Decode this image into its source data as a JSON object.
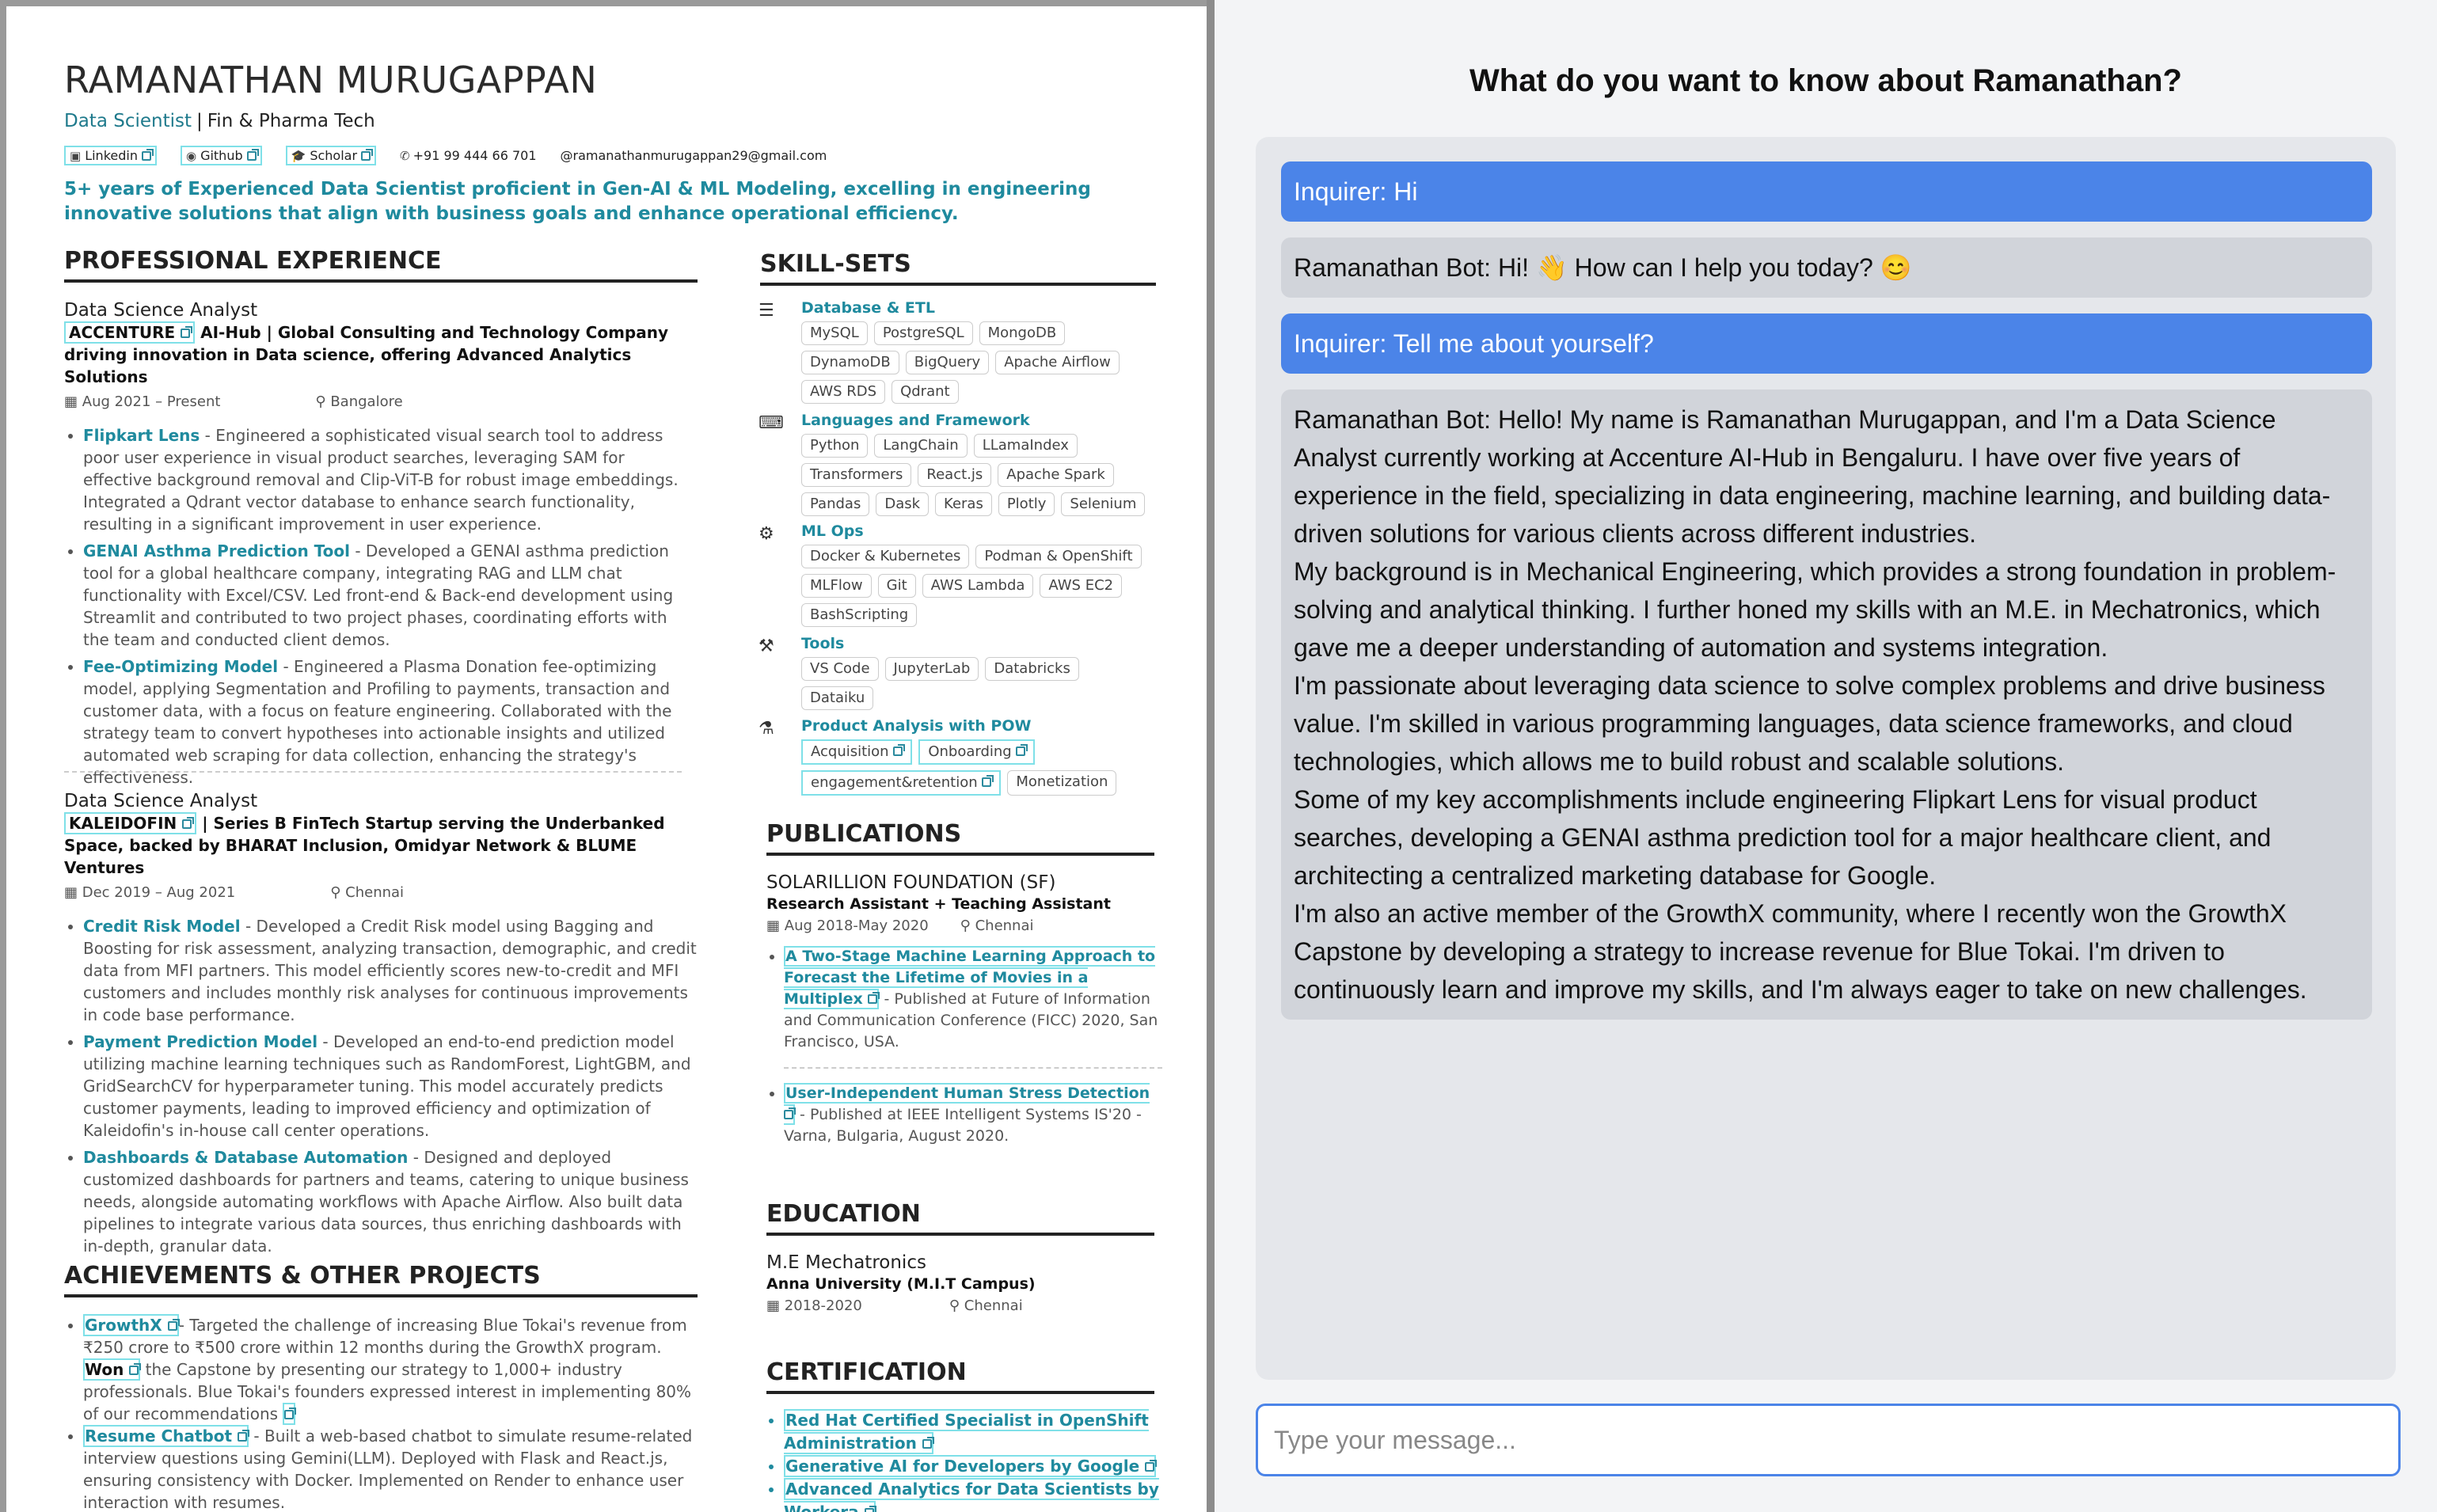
{
  "resume": {
    "name": "RAMANATHAN MURUGAPPAN",
    "role": "Data Scientist",
    "domain": "Fin & Pharma Tech",
    "links": [
      {
        "label": "Linkedin",
        "icon": "linkedin-icon"
      },
      {
        "label": "Github",
        "icon": "github-icon"
      },
      {
        "label": "Scholar",
        "icon": "graduation-cap-icon"
      }
    ],
    "phone": "+91 99 444 66 701",
    "email": "@ramanathanmurugappan29@gmail.com",
    "summary": "5+ years of Experienced Data Scientist proficient in Gen-AI & ML Modeling, excelling in engineering innovative solutions that align with business goals and enhance operational efficiency.",
    "sections": {
      "experience": "PROFESSIONAL EXPERIENCE",
      "skills": "SKILL-SETS",
      "publications": "PUBLICATIONS",
      "education": "EDUCATION",
      "certification": "CERTIFICATION",
      "achievements": "ACHIEVEMENTS & OTHER PROJECTS"
    },
    "jobs": [
      {
        "title": "Data Science Analyst",
        "company": "ACCENTURE",
        "company_desc": "AI-Hub | Global Consulting and Technology Company driving innovation in Data science, offering Advanced Analytics Solutions",
        "dates": "Aug 2021 – Present",
        "location": "Bangalore",
        "bullets": [
          {
            "head": "Flipkart Lens",
            "text": " - Engineered a sophisticated visual search tool to address poor user experience in visual product searches, leveraging SAM for effective background removal and Clip-ViT-B for robust image embeddings. Integrated a Qdrant vector database to enhance search functionality, resulting in a significant improvement in user experience."
          },
          {
            "head": "GENAI Asthma Prediction Tool",
            "text": " - Developed a GENAI asthma prediction tool for a global healthcare company, integrating RAG and LLM chat functionality with Excel/CSV. Led front-end & Back-end development using Streamlit and contributed to two project phases, coordinating efforts with the team and conducted client demos."
          },
          {
            "head": "Fee-Optimizing Model",
            "text": " - Engineered a Plasma Donation fee-optimizing model, applying Segmentation and Profiling to payments, transaction and customer data, with a focus on feature engineering. Collaborated with the strategy team to convert hypotheses into actionable insights and utilized automated web scraping for data collection, enhancing the strategy's effectiveness."
          }
        ]
      },
      {
        "title": "Data Science Analyst",
        "company": "KALEIDOFIN",
        "company_desc": "| Series B FinTech Startup serving the Underbanked Space, backed by BHARAT Inclusion, Omidyar Network & BLUME Ventures",
        "dates": "Dec 2019 – Aug 2021",
        "location": "Chennai",
        "bullets": [
          {
            "head": "Credit Risk Model",
            "text": " - Developed a Credit Risk model using Bagging and Boosting for risk assessment, analyzing transaction, demographic, and credit data from MFI partners. This model efficiently scores new-to-credit and MFI customers and includes monthly risk analyses for continuous improvements in code base performance."
          },
          {
            "head": "Payment Prediction Model",
            "text": " - Developed an end-to-end prediction model utilizing machine learning techniques such as RandomForest, LightGBM, and GridSearchCV for hyperparameter tuning. This model accurately predicts customer payments, leading to improved efficiency and optimization of Kaleidofin's in-house call center operations."
          },
          {
            "head": "Dashboards & Database Automation",
            "text": " - Designed and deployed customized dashboards for partners and teams, catering to unique business needs, alongside automating workflows with Apache Airflow. Also built data pipelines to integrate various data sources, thus enriching dashboards with in-depth, granular data."
          }
        ]
      }
    ],
    "skill_groups": [
      {
        "name": "Database & ETL",
        "icon": "database-icon",
        "tags": [
          "MySQL",
          "PostgreSQL",
          "MongoDB",
          "DynamoDB",
          "BigQuery",
          "Apache Airflow",
          "AWS RDS",
          "Qdrant"
        ]
      },
      {
        "name": "Languages and Framework",
        "icon": "code-file-icon",
        "tags": [
          "Python",
          "LangChain",
          "LLamaIndex",
          "Transformers",
          "React.js",
          "Apache Spark",
          "Pandas",
          "Dask",
          "Keras",
          "Plotly",
          "Selenium"
        ]
      },
      {
        "name": "ML Ops",
        "icon": "gears-icon",
        "tags": [
          "Docker & Kubernetes",
          "Podman & OpenShift",
          "MLFlow",
          "Git",
          "AWS Lambda",
          "AWS EC2",
          "BashScripting"
        ]
      },
      {
        "name": "Tools",
        "icon": "hammer-icon",
        "tags": [
          "VS Code",
          "JupyterLab",
          "Databricks",
          "Dataiku"
        ]
      },
      {
        "name": "Product Analysis with POW",
        "icon": "flask-icon",
        "tags": [
          "Acquisition",
          "Onboarding",
          "engagement&retention",
          "Monetization"
        ]
      }
    ],
    "publication": {
      "org": "SOLARILLION FOUNDATION (SF)",
      "position": "Research Assistant + Teaching Assistant",
      "dates": "Aug 2018-May 2020",
      "location": "Chennai",
      "items": [
        {
          "title": "A Two-Stage Machine Learning Approach to Forecast the Lifetime of Movies in a Multiplex",
          "desc": "- Published at Future of Information and Communication Conference (FICC) 2020, San Francisco, USA."
        },
        {
          "title": "User-Independent Human Stress Detection",
          "desc": "- Published at IEEE Intelligent Systems IS'20 - Varna, Bulgaria, August 2020."
        }
      ]
    },
    "education": {
      "degree": "M.E Mechatronics",
      "school": "Anna University (M.I.T Campus)",
      "dates": "2018-2020",
      "location": "Chennai"
    },
    "certifications": [
      "Red Hat Certified Specialist in OpenShift Administration",
      "Generative AI for Developers by Google",
      "Advanced Analytics for Data Scientists by Workera"
    ],
    "achievements": [
      {
        "head": "GrowthX",
        "text": "- Targeted the challenge of increasing Blue Tokai's revenue from ₹250 crore to ₹500 crore within 12 months during the GrowthX program.",
        "won": "Won",
        "text2": " the Capstone by presenting our strategy to 1,000+ industry professionals. Blue Tokai's founders expressed interest in implementing 80% of our recommendations"
      },
      {
        "head": "Resume Chatbot",
        "text": " - Built a web-based chatbot to simulate resume-related interview questions using Gemini(LLM). Deployed with Flask and React.js, ensuring consistency with Docker. Implemented on Render to enhance user interaction with resumes."
      }
    ]
  },
  "chat": {
    "title": "What do you want to know about Ramanathan?",
    "messages": [
      {
        "role": "user",
        "text": "Inquirer: Hi"
      },
      {
        "role": "bot",
        "text": "Ramanathan Bot: Hi! 👋 How can I help you today? 😊"
      },
      {
        "role": "user",
        "text": "Inquirer: Tell me about yourself?"
      },
      {
        "role": "bot",
        "paragraphs": [
          "Ramanathan Bot: Hello! My name is Ramanathan Murugappan, and I'm a Data Science Analyst currently working at Accenture AI-Hub in Bengaluru. I have over five years of experience in the field, specializing in data engineering, machine learning, and building data-driven solutions for various clients across different industries.",
          "My background is in Mechanical Engineering, which provides a strong foundation in problem-solving and analytical thinking. I further honed my skills with an M.E. in Mechatronics, which gave me a deeper understanding of automation and systems integration.",
          "I'm passionate about leveraging data science to solve complex problems and drive business value. I'm skilled in various programming languages, data science frameworks, and cloud technologies, which allows me to build robust and scalable solutions.",
          "Some of my key accomplishments include engineering Flipkart Lens for visual product searches, developing a GENAI asthma prediction tool for a major healthcare client, and architecting a centralized marketing database for Google.",
          "I'm also an active member of the GrowthX community, where I recently won the GrowthX Capstone by developing a strategy to increase revenue for Blue Tokai. I'm driven to continuously learn and improve my skills, and I'm always eager to take on new challenges."
        ]
      }
    ],
    "input_placeholder": "Type your message...",
    "colors": {
      "user_bubble": "#4b84e8",
      "bot_bubble": "#d1d4da",
      "accent": "#1f8a9e"
    }
  }
}
